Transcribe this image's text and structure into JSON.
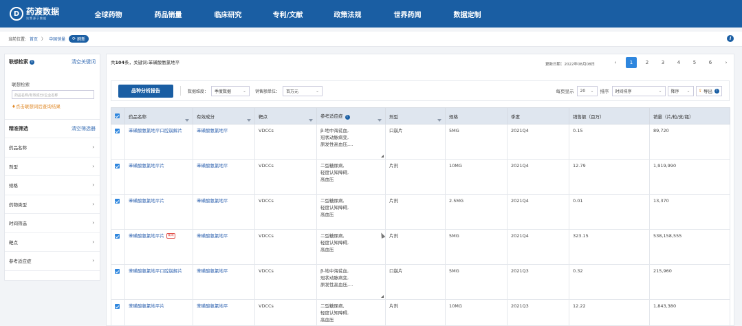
{
  "brand": {
    "title": "药渡数据",
    "subtitle": "决策源于数据",
    "mark": "D"
  },
  "nav": [
    "全球药物",
    "药品销量",
    "临床研究",
    "专利/文献",
    "政策法规",
    "世界药闻",
    "数据定制"
  ],
  "breadcrumb": {
    "prefix": "当前位置:",
    "home": "首页",
    "sep": "〉",
    "current": "中国销量",
    "refresh": "刷新",
    "info": "i"
  },
  "sidebar": {
    "assoc_title": "联想检索",
    "assoc_clear": "清空关键词",
    "assoc_label": "联想检索",
    "assoc_placeholder": "药品名称/有效成分/企业名称",
    "assoc_hint": "点击联想词后查询结果",
    "filter_title": "精准筛选",
    "filter_clear": "清空筛选器",
    "filters": [
      "药品名称",
      "剂型",
      "规格",
      "药物类型",
      "时间筛选",
      "靶点",
      "参考适应症"
    ]
  },
  "summary": {
    "prefix": "共",
    "count": "104",
    "mid": "条，关键词:",
    "keyword": "苯磺酸氨氯地平"
  },
  "update": "更新日期：2022年08月08日",
  "pager": {
    "prev": "‹",
    "pages": [
      "1",
      "2",
      "3",
      "4",
      "5",
      "6"
    ],
    "next": "›",
    "active": "1"
  },
  "toolbar": {
    "analysis_button": "品种分析报告",
    "dim_label": "数据维度：",
    "dim_value": "季度数据",
    "unit_label": "销售额单位：",
    "unit_value": "百万元",
    "per_page_label": "每页显示",
    "per_page_value": "20",
    "sort_label": "排序",
    "sort_field": "时间排序",
    "sort_order": "降序",
    "export": "导出"
  },
  "table": {
    "headers": [
      "药品名称",
      "有效成分",
      "靶点",
      "参考适应症",
      "剂型",
      "规格",
      "季度",
      "销售额（百万）",
      "销量（片/粒/支/瓶）"
    ],
    "rows": [
      {
        "name": "苯磺酸氨氯地平口腔崩解片",
        "tag": "",
        "ingredient": "苯磺酸氨氯地平",
        "target": "VDCCs",
        "indication": [
          "β-地中海贫血,",
          "冠状动脉病变,",
          "原发性高血压,..."
        ],
        "form": "口崩片",
        "spec": "5MG",
        "quarter": "2021Q4",
        "sales": "0.15",
        "volume": "89,720"
      },
      {
        "name": "苯磺酸氨氯地平片",
        "tag": "",
        "ingredient": "苯磺酸氨氯地平",
        "target": "VDCCs",
        "indication": [
          "二型糖尿病,",
          "轻度认知障碍,",
          "高血压"
        ],
        "form": "片剂",
        "spec": "10MG",
        "quarter": "2021Q4",
        "sales": "12.79",
        "volume": "1,919,990"
      },
      {
        "name": "苯磺酸氨氯地平片",
        "tag": "",
        "ingredient": "苯磺酸氨氯地平",
        "target": "VDCCs",
        "indication": [
          "二型糖尿病,",
          "轻度认知障碍,",
          "高血压"
        ],
        "form": "片剂",
        "spec": "2.5MG",
        "quarter": "2021Q4",
        "sales": "0.01",
        "volume": "13,370"
      },
      {
        "name": "苯磺酸氨氯地平片",
        "tag": "集采",
        "ingredient": "苯磺酸氨氯地平",
        "target": "VDCCs",
        "indication": [
          "二型糖尿病,",
          "轻度认知障碍,",
          "高血压"
        ],
        "form": "片剂",
        "spec": "5MG",
        "quarter": "2021Q4",
        "sales": "323.15",
        "volume": "538,158,555"
      },
      {
        "name": "苯磺酸氨氯地平口腔崩解片",
        "tag": "",
        "ingredient": "苯磺酸氨氯地平",
        "target": "VDCCs",
        "indication": [
          "β-地中海贫血,",
          "冠状动脉病变,",
          "原发性高血压,..."
        ],
        "form": "口崩片",
        "spec": "5MG",
        "quarter": "2021Q3",
        "sales": "0.32",
        "volume": "215,960"
      },
      {
        "name": "苯磺酸氨氯地平片",
        "tag": "",
        "ingredient": "苯磺酸氨氯地平",
        "target": "VDCCs",
        "indication": [
          "二型糖尿病,",
          "轻度认知障碍,",
          "高血压"
        ],
        "form": "片剂",
        "spec": "10MG",
        "quarter": "2021Q3",
        "sales": "12.22",
        "volume": "1,843,380"
      }
    ]
  }
}
